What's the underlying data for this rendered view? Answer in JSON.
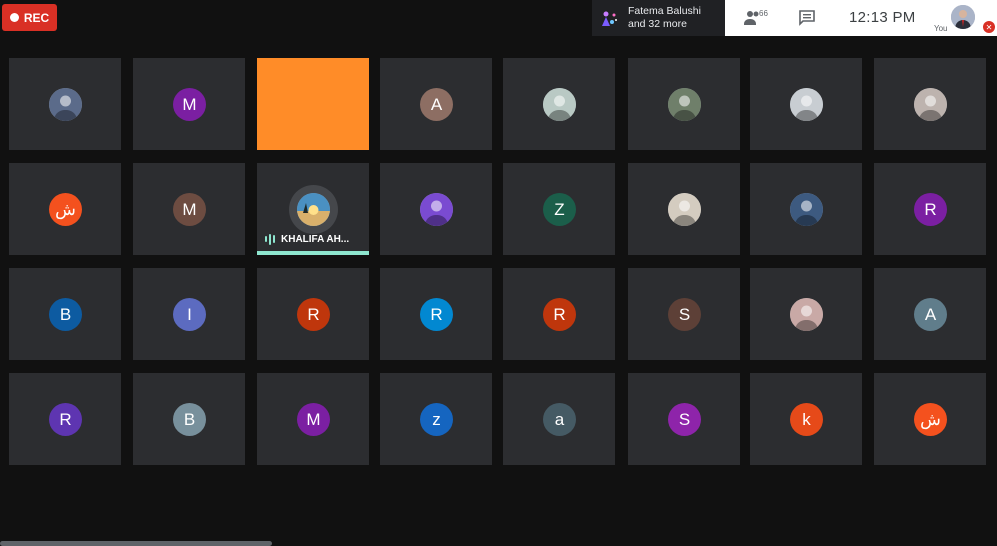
{
  "recording": {
    "label": "REC",
    "color": "#d93025"
  },
  "presenter": {
    "line1": "Fatema Balushi",
    "line2": "and 32 more"
  },
  "topbar": {
    "time": "12:13 PM",
    "you_label": "You",
    "people_icon": "people-icon",
    "chat_icon": "chat-icon"
  },
  "speaker": {
    "name": "KHALIFA AH...",
    "accent": "#8ee6cf"
  },
  "tiles": [
    {
      "kind": "photo",
      "label": "",
      "color": "#5b6b8a"
    },
    {
      "kind": "letter",
      "label": "M",
      "color": "#7b1fa2"
    },
    {
      "kind": "blank",
      "label": "",
      "color": "#ff8c28"
    },
    {
      "kind": "letter",
      "label": "A",
      "color": "#8d6e63"
    },
    {
      "kind": "photo",
      "label": "",
      "color": "#b9c9c4"
    },
    {
      "kind": "photo",
      "label": "",
      "color": "#6f7f6a"
    },
    {
      "kind": "photo",
      "label": "",
      "color": "#c8cdd2"
    },
    {
      "kind": "photo",
      "label": "",
      "color": "#bdb3ae"
    },
    {
      "kind": "letter",
      "label": "ش",
      "color": "#f4511e"
    },
    {
      "kind": "letter",
      "label": "M",
      "color": "#6d4c41"
    },
    {
      "kind": "speaking",
      "label": "",
      "color": "#d9b06b"
    },
    {
      "kind": "photo",
      "label": "",
      "color": "#7a4bd1"
    },
    {
      "kind": "letter",
      "label": "Z",
      "color": "#1b5e4a"
    },
    {
      "kind": "photo",
      "label": "",
      "color": "#d4ccc0"
    },
    {
      "kind": "photo",
      "label": "",
      "color": "#3d5a80"
    },
    {
      "kind": "letter",
      "label": "R",
      "color": "#7b1fa2"
    },
    {
      "kind": "letter",
      "label": "B",
      "color": "#0d5ba1"
    },
    {
      "kind": "letter",
      "label": "I",
      "color": "#5c6bc0"
    },
    {
      "kind": "letter",
      "label": "R",
      "color": "#bf360c"
    },
    {
      "kind": "letter",
      "label": "R",
      "color": "#0288d1"
    },
    {
      "kind": "letter",
      "label": "R",
      "color": "#bf360c"
    },
    {
      "kind": "letter",
      "label": "S",
      "color": "#5d4037"
    },
    {
      "kind": "photo",
      "label": "",
      "color": "#c9a9a6"
    },
    {
      "kind": "letter",
      "label": "A",
      "color": "#607d8b"
    },
    {
      "kind": "letter",
      "label": "R",
      "color": "#5e35b1"
    },
    {
      "kind": "letter",
      "label": "B",
      "color": "#78909c"
    },
    {
      "kind": "letter",
      "label": "M",
      "color": "#7b1fa2"
    },
    {
      "kind": "letter",
      "label": "z",
      "color": "#1565c0"
    },
    {
      "kind": "letter",
      "label": "a",
      "color": "#455a64"
    },
    {
      "kind": "letter",
      "label": "S",
      "color": "#8e24aa"
    },
    {
      "kind": "letter",
      "label": "k",
      "color": "#e64a19"
    },
    {
      "kind": "letter",
      "label": "ش",
      "color": "#f4511e"
    }
  ]
}
